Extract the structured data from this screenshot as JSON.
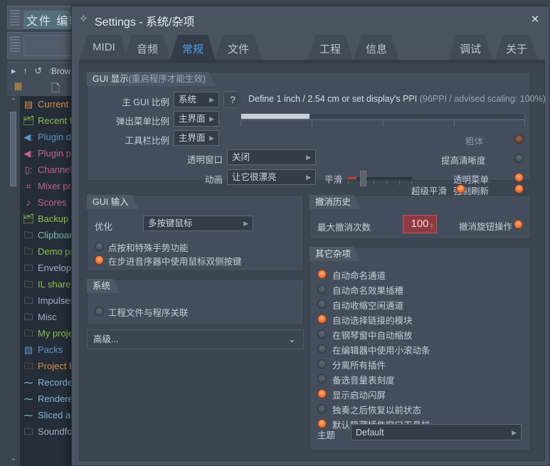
{
  "background": {
    "menu": "文件 编辑",
    "browser_label": "Brow",
    "browser_icons": "▸ ↑ ↺ ◌",
    "items": [
      {
        "label": "Current p",
        "icon": "▤",
        "color": "#d98c4a"
      },
      {
        "label": "Recent fi",
        "icon": "🗂",
        "color": "#8fbf4f"
      },
      {
        "label": "Plugin da",
        "icon": "◀:",
        "color": "#5d94c7"
      },
      {
        "label": "Plugin pr",
        "icon": "◀:",
        "color": "#c0648f"
      },
      {
        "label": "Channel",
        "icon": "▯:",
        "color": "#c0648f"
      },
      {
        "label": "Mixer pr",
        "icon": "⌗",
        "color": "#c0648f"
      },
      {
        "label": "Scores",
        "icon": "♪",
        "color": "#c0648f"
      },
      {
        "label": "Backup",
        "icon": "🗂",
        "color": "#8fbf4f"
      },
      {
        "label": "Clipboar",
        "icon": "🗀",
        "color": "#7fb8a8"
      },
      {
        "label": "Demo pr",
        "icon": "🗀",
        "color": "#8fbf4f"
      },
      {
        "label": "Envelope",
        "icon": "🗀",
        "color": "#9fb0bf"
      },
      {
        "label": "IL shared",
        "icon": "🗀",
        "color": "#8fbf4f"
      },
      {
        "label": "Impulses",
        "icon": "🗀",
        "color": "#9fb0bf"
      },
      {
        "label": "Misc",
        "icon": "🗀",
        "color": "#9fb0bf"
      },
      {
        "label": "My proje",
        "icon": "🗀",
        "color": "#8fbf4f"
      },
      {
        "label": "Packs",
        "icon": "▨",
        "color": "#5d94c7"
      },
      {
        "label": "Project b",
        "icon": "🗀",
        "color": "#d98c4a"
      },
      {
        "label": "Recorded",
        "icon": "⁓",
        "color": "#7fb8d8"
      },
      {
        "label": "Rendered",
        "icon": "⁓",
        "color": "#7fb8d8"
      },
      {
        "label": "Sliced au",
        "icon": "⁓",
        "color": "#7fb8d8"
      },
      {
        "label": "Soundfon",
        "icon": "🗀",
        "color": "#9fb0bf"
      }
    ]
  },
  "dialog": {
    "title": "Settings - 系统/杂项",
    "close_label": "✕",
    "gear_icon": "✧",
    "tabs": [
      {
        "label": "MIDI",
        "selected": false
      },
      {
        "label": "音频",
        "selected": false
      },
      {
        "label": "常规",
        "selected": true
      },
      {
        "label": "文件",
        "selected": false
      },
      {
        "label": "工程",
        "selected": false
      },
      {
        "label": "信息",
        "selected": false
      },
      {
        "label": "调试",
        "selected": false
      },
      {
        "label": "关于",
        "selected": false
      }
    ]
  },
  "gui_display": {
    "title_main": "GUI 显示",
    "title_note": "(重启程序才能生效)",
    "rows": [
      {
        "label": "主 GUI 比例",
        "value": "系统"
      },
      {
        "label": "弹出菜单比例",
        "value": "主界面"
      },
      {
        "label": "工具栏比例",
        "value": "主界面"
      }
    ],
    "transparent_window": {
      "label": "透明窗口",
      "value": "关闭"
    },
    "animation": {
      "label": "动画",
      "value": "让它很漂亮"
    },
    "help_glyph": "?",
    "ppi_text": "Define 1 inch / 2.54 cm or set display's PPI ",
    "ppi_hint": "(96PPI / advised scaling: 100%)",
    "ruler_fill_percent": 24,
    "smooth": {
      "label": "平滑",
      "value_percent": 33
    },
    "toggles": [
      {
        "label": "粗体",
        "state": "dis"
      },
      {
        "label": "提高清晰度",
        "state": "off"
      },
      {
        "label": "透明菜单",
        "state": "on"
      },
      {
        "label": "强制刷新",
        "state": "on"
      },
      {
        "label": "超级平滑",
        "state": "on"
      }
    ]
  },
  "gui_input": {
    "title": "GUI 输入",
    "optimize_label": "优化",
    "optimize_value": "多按键鼠标",
    "options": [
      {
        "label": "点按和特殊手势功能",
        "state": "off"
      },
      {
        "label": "在步进音序器中使用鼠标双侧按键",
        "state": "on"
      }
    ]
  },
  "system": {
    "title": "系统",
    "options": [
      {
        "label": "工程文件与程序关联",
        "state": "off"
      }
    ]
  },
  "advanced": {
    "label": "高级...",
    "chevron": "⌄"
  },
  "undo_history": {
    "title": "撤消历史",
    "max_undo_label": "最大撤消次数",
    "max_undo_value": "100",
    "undo_knob": {
      "label": "撤消旋钮操作",
      "state": "on"
    }
  },
  "misc": {
    "title": "其它杂项",
    "options": [
      {
        "label": "自动命名通道",
        "state": "on"
      },
      {
        "label": "自动命名效果插槽",
        "state": "off"
      },
      {
        "label": "自动收缩空闲通道",
        "state": "off"
      },
      {
        "label": "自动选择链接的模块",
        "state": "on"
      },
      {
        "label": "在钢琴窗中自动缩放",
        "state": "off"
      },
      {
        "label": "在编辑器中使用小滚动条",
        "state": "off"
      },
      {
        "label": "分离所有插件",
        "state": "off"
      },
      {
        "label": "备选音量表刻度",
        "state": "off"
      },
      {
        "label": "显示启动闪屏",
        "state": "on"
      },
      {
        "label": "独奏之后恢复以前状态",
        "state": "off"
      },
      {
        "label": "默认隐藏插件窗口工具栏",
        "state": "on"
      }
    ],
    "theme_label": "主题",
    "theme_value": "Default"
  }
}
